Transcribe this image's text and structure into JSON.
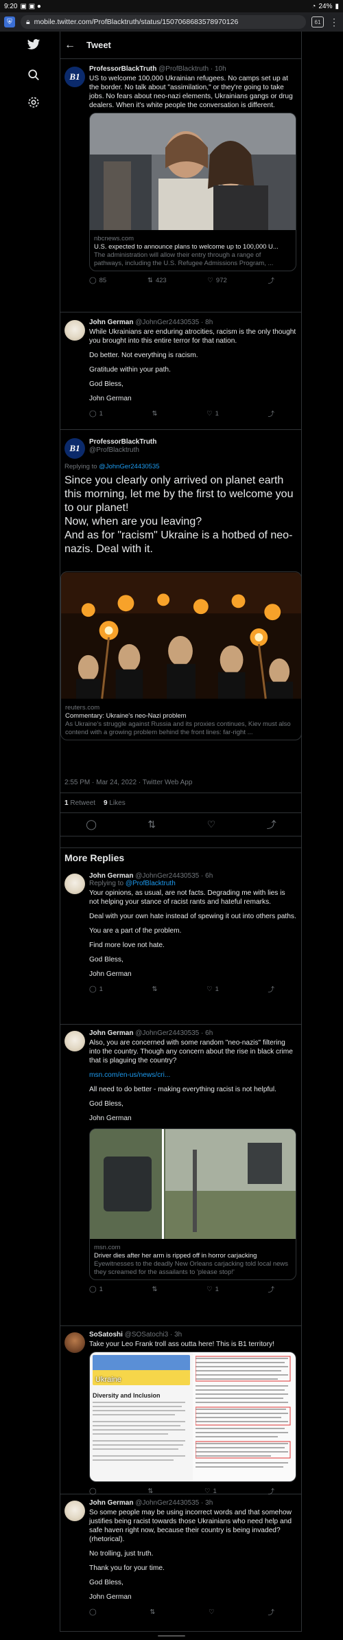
{
  "status": {
    "time": "9:20",
    "battery": "24%"
  },
  "browser": {
    "url": "mobile.twitter.com/ProfBlacktruth/status/1507068683578970126",
    "tab_count": "61"
  },
  "header": {
    "title": "Tweet"
  },
  "tweets": [
    {
      "name": "ProfessorBlackTruth",
      "handle": "@ProfBlacktruth · 10h",
      "text": "US to welcome 100,000 Ukrainian refugees. No camps set up at the border. No talk about \"assimilation,\" or they're going to take jobs. No fears about neo-nazi elements, Ukrainians gangs or drug dealers. When it's white people the conversation is different.",
      "card_domain": "nbcnews.com",
      "card_title": "U.S. expected to announce plans to welcome up to 100,000 U...",
      "card_desc": "The administration will allow their entry through a range of pathways, including the U.S. Refugee Admissions Program, ...",
      "replies": "85",
      "retweets": "423",
      "likes": "972"
    },
    {
      "name": "John German",
      "handle": "@JohnGer24430535 · 8h",
      "p1": "While Ukrainians are enduring atrocities, racism is the only thought you brought into this entire terror for that nation.",
      "p2": "Do better.  Not everything is racism.",
      "p3": "Gratitude within your path.",
      "p4": "God Bless,",
      "p5": "John German",
      "replies": "1",
      "retweets": "",
      "likes": "1"
    }
  ],
  "focus": {
    "name": "ProfessorBlackTruth",
    "handle": "@ProfBlacktruth",
    "replying_label": "Replying to",
    "replying_to": "@JohnGer24430535",
    "text1": "Since you clearly only arrived on planet earth this morning, let me by the first to welcome you to our planet!",
    "text2": "Now, when are you leaving?",
    "text3": "And as for \"racism\" Ukraine is a hotbed of neo-nazis. Deal with it.",
    "card_domain": "reuters.com",
    "card_title": "Commentary: Ukraine's neo-Nazi problem",
    "card_desc": "As Ukraine's struggle against Russia and its proxies continues, Kiev must also contend with a growing problem behind the front lines: far-right ...",
    "timestamp": "2:55 PM · Mar 24, 2022 · Twitter Web App",
    "retweets_count": "1",
    "retweets_label": "Retweet",
    "likes_count": "9",
    "likes_label": "Likes"
  },
  "more_replies_title": "More Replies",
  "replies": [
    {
      "name": "John German",
      "handle": "@JohnGer24430535 · 6h",
      "replying_label": "Replying to",
      "replying_to": "@ProfBlacktruth",
      "p1": "Your opinions, as usual, are not facts.  Degrading me with lies is not helping your stance of racist rants and hateful remarks.",
      "p2": "Deal with your own hate instead of spewing it out into others paths.",
      "p3": "You are a part of the problem.",
      "p4": "Find more love not hate.",
      "p5": "God Bless,",
      "p6": "John German",
      "replies": "1",
      "likes": "1"
    },
    {
      "name": "John German",
      "handle": "@JohnGer24430535 · 6h",
      "p1": "Also, you are concerned with some random \"neo-nazis\" filtering into the country.  Though any concern about the rise in black crime that is plaguing the country?",
      "link": "msn.com/en-us/news/cri...",
      "p2": "All need to do better - making everything racist is not helpful.",
      "p3": "God Bless,",
      "p4": "John German",
      "card_domain": "msn.com",
      "card_title": "Driver dies after her arm is ripped off in horror carjacking",
      "card_desc": "Eyewitnesses to the deadly New Orleans carjacking told local news they screamed for the assailants to 'please stop!'",
      "replies": "1",
      "likes": "1"
    },
    {
      "name": "SoSatoshi",
      "handle": "@SOSatochi3 · 3h",
      "text": "Take your Leo Frank troll ass outta here! This is B1 territory!",
      "doc_title": "Ukraine",
      "doc_heading": "Diversity and Inclusion",
      "replies": "",
      "likes": "1"
    },
    {
      "name": "John German",
      "handle": "@JohnGer24430535 · 3h",
      "p1": "So some people may be using incorrect words and that somehow justifies being racist towards those Ukrainians who need help and safe haven right now, because their country is being invaded? (rhetorical).",
      "p2": "No trolling, just truth.",
      "p3": "Thank you for your time.",
      "p4": "God Bless,",
      "p5": "John German",
      "replies": "",
      "likes": ""
    }
  ]
}
